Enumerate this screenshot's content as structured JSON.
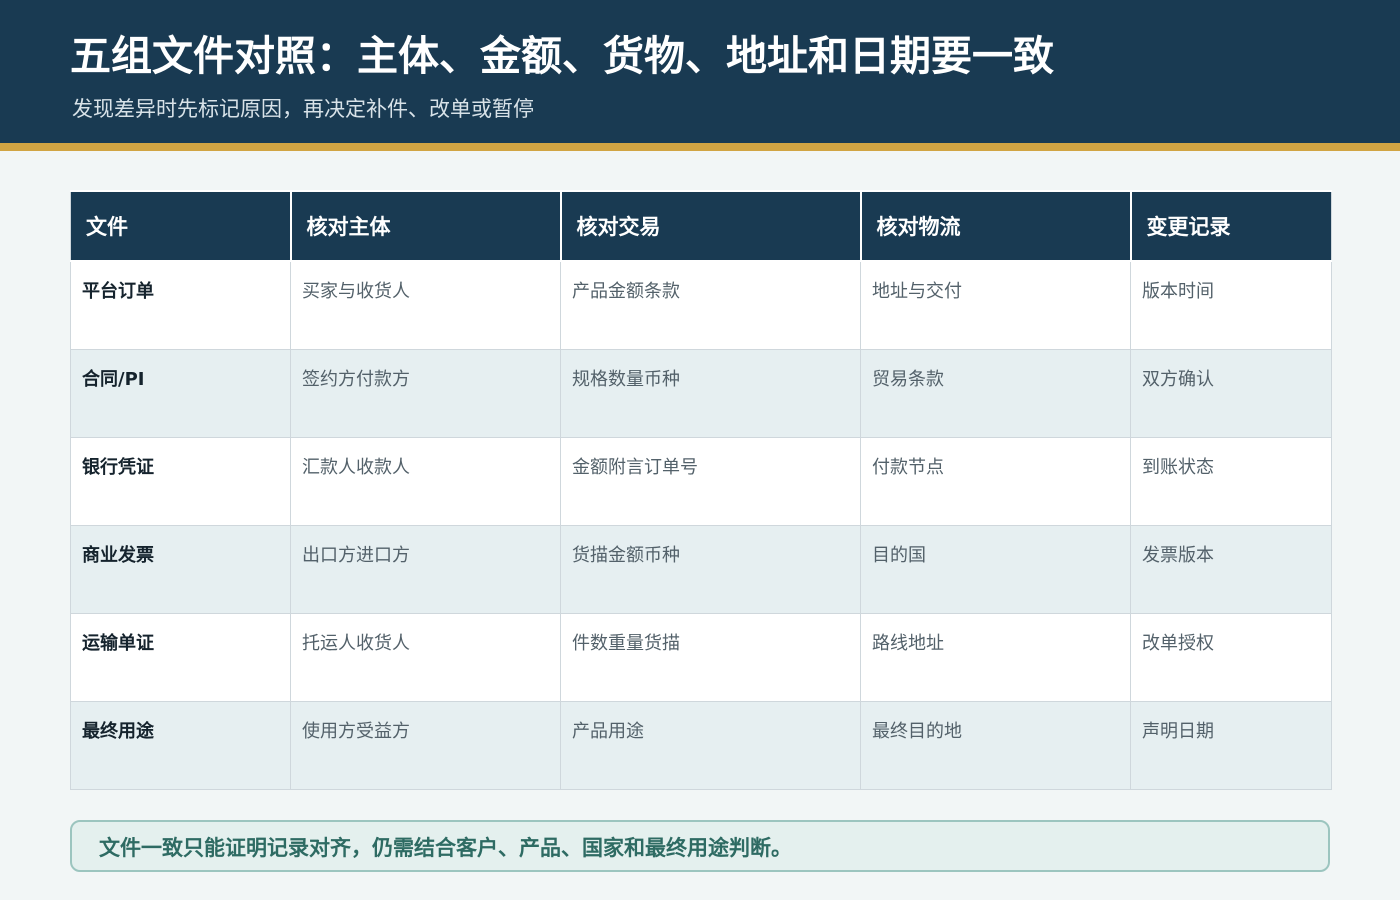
{
  "header": {
    "title": "五组文件对照：主体、金额、货物、地址和日期要一致",
    "subtitle": "发现差异时先标记原因，再决定补件、改单或暂停"
  },
  "table": {
    "headers": [
      "文件",
      "核对主体",
      "核对交易",
      "核对物流",
      "变更记录"
    ],
    "rows": [
      [
        "平台订单",
        "买家与收货人",
        "产品金额条款",
        "地址与交付",
        "版本时间"
      ],
      [
        "合同/PI",
        "签约方付款方",
        "规格数量币种",
        "贸易条款",
        "双方确认"
      ],
      [
        "银行凭证",
        "汇款人收款人",
        "金额附言订单号",
        "付款节点",
        "到账状态"
      ],
      [
        "商业发票",
        "出口方进口方",
        "货描金额币种",
        "目的国",
        "发票版本"
      ],
      [
        "运输单证",
        "托运人收货人",
        "件数重量货描",
        "路线地址",
        "改单授权"
      ],
      [
        "最终用途",
        "使用方受益方",
        "产品用途",
        "最终目的地",
        "声明日期"
      ]
    ]
  },
  "note": {
    "text": "文件一致只能证明记录对齐，仍需结合客户、产品、国家和最终用途判断。"
  },
  "colors": {
    "header_bg": "#193a52",
    "accent_bar": "#d1a443",
    "row_alt_bg": "#e6eff1",
    "note_text": "#2e6b63"
  }
}
